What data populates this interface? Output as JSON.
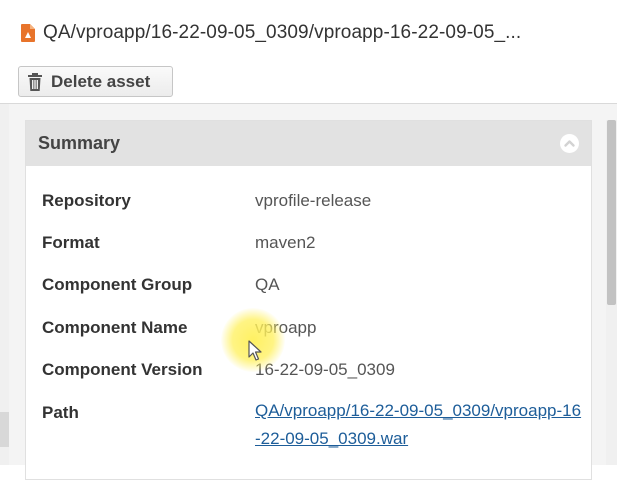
{
  "header": {
    "title": "QA/vproapp/16-22-09-05_0309/vproapp-16-22-09-05_...",
    "file_icon": "file-archive-icon"
  },
  "toolbar": {
    "delete_label": "Delete asset",
    "delete_icon": "trash-icon"
  },
  "summary": {
    "title": "Summary",
    "collapse_icon": "chevron-up-icon",
    "rows": [
      {
        "label": "Repository",
        "value": "vprofile-release"
      },
      {
        "label": "Format",
        "value": "maven2"
      },
      {
        "label": "Component Group",
        "value": "QA"
      },
      {
        "label": "Component Name",
        "value": "vproapp"
      },
      {
        "label": "Component Version",
        "value": "16-22-09-05_0309"
      },
      {
        "label": "Path",
        "value": "QA/vproapp/16-22-09-05_0309/vproapp-16-22-09-05_0309.war"
      }
    ]
  },
  "colors": {
    "accent_icon": "#e8742b",
    "link": "#1d5d99",
    "panel_header": "#e2e2e2"
  }
}
